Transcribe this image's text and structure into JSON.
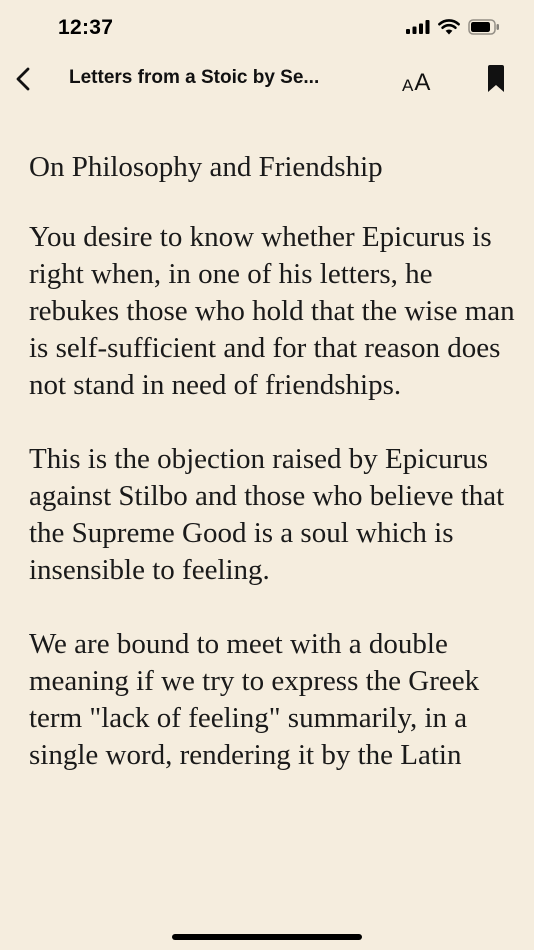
{
  "status_bar": {
    "time": "12:37"
  },
  "nav": {
    "title": "Letters from a Stoic by Se...",
    "font_small": "A",
    "font_big": "A"
  },
  "content": {
    "heading": "On Philosophy and Friendship",
    "paragraphs": [
      "You desire to know whether Epicurus is right when, in one of his letters, he rebukes those who hold that the wise man is self-sufficient and for that reason does not stand in need of friendships.",
      "This is the objection raised by Epicurus against Stilbo and those who believe that the Supreme Good is a soul which is insensible to feeling.",
      "We are bound to meet with a double meaning if we try to express the Greek term \"lack of feeling\" summarily, in a single word, rendering it by the Latin"
    ]
  },
  "icons": {
    "signal": "cellular-signal-icon",
    "wifi": "wifi-icon",
    "battery": "battery-icon",
    "back": "chevron-left-icon",
    "bookmark": "bookmark-icon"
  }
}
